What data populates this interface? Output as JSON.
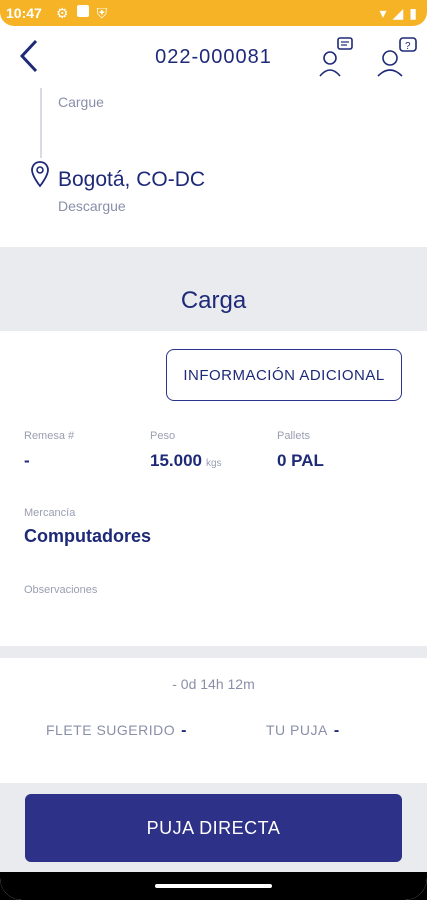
{
  "status": {
    "time": "10:47"
  },
  "header": {
    "trip_id": "022-000081"
  },
  "route": {
    "origin_label": "Cargue",
    "destination": "Bogotá, CO-DC",
    "destination_label": "Descargue"
  },
  "section": {
    "title": "Carga"
  },
  "cargo": {
    "info_button": "INFORMACIÓN ADICIONAL",
    "remesa_label": "Remesa #",
    "remesa_value": "-",
    "peso_label": "Peso",
    "peso_value": "15.000",
    "peso_unit": "kgs",
    "pallets_label": "Pallets",
    "pallets_value": "0 PAL",
    "mercancia_label": "Mercancía",
    "mercancia_value": "Computadores",
    "observaciones_label": "Observaciones"
  },
  "bid": {
    "timer": "- 0d 14h 12m",
    "suggested_label": "FLETE SUGERIDO",
    "suggested_value": "-",
    "your_bid_label": "TU PUJA",
    "your_bid_value": "-",
    "cta_label": "PUJA DIRECTA"
  },
  "colors": {
    "primary": "#2d3188",
    "status_bar": "#f5b325",
    "text_dark": "#1e2a78"
  }
}
